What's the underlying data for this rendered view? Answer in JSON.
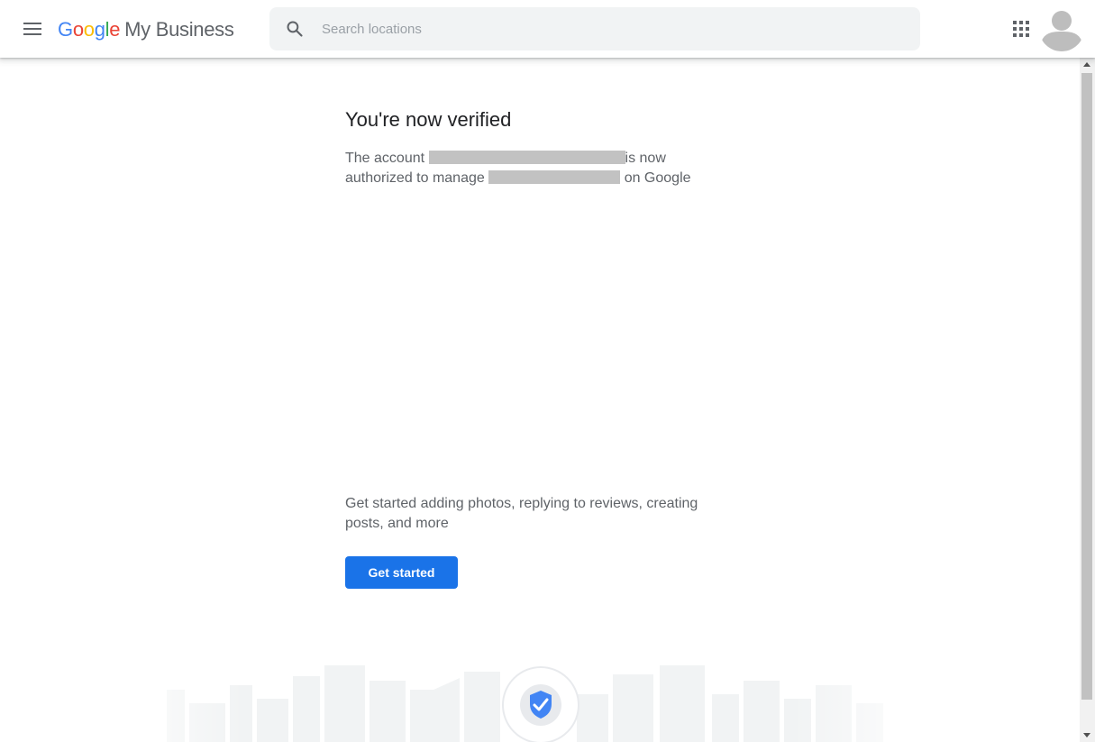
{
  "header": {
    "logo": {
      "letters": [
        "G",
        "o",
        "o",
        "g",
        "l",
        "e"
      ],
      "product": "My Business"
    },
    "search": {
      "placeholder": "Search locations",
      "value": ""
    }
  },
  "main": {
    "title": "You're now verified",
    "description": {
      "prefix": "The account",
      "middle": "is now authorized to manage",
      "suffix": "on Google"
    },
    "cta_text": "Get started adding photos, replying to reviews, creating posts, and more",
    "cta_button": "Get started"
  },
  "colors": {
    "accent": "#1a73e8",
    "google_blue": "#4285f4",
    "google_red": "#ea4335",
    "google_yellow": "#fbbc05",
    "google_green": "#34a853"
  },
  "icons": [
    "menu-icon",
    "search-icon",
    "apps-grid-icon",
    "account-avatar-icon",
    "verified-shield-icon"
  ]
}
